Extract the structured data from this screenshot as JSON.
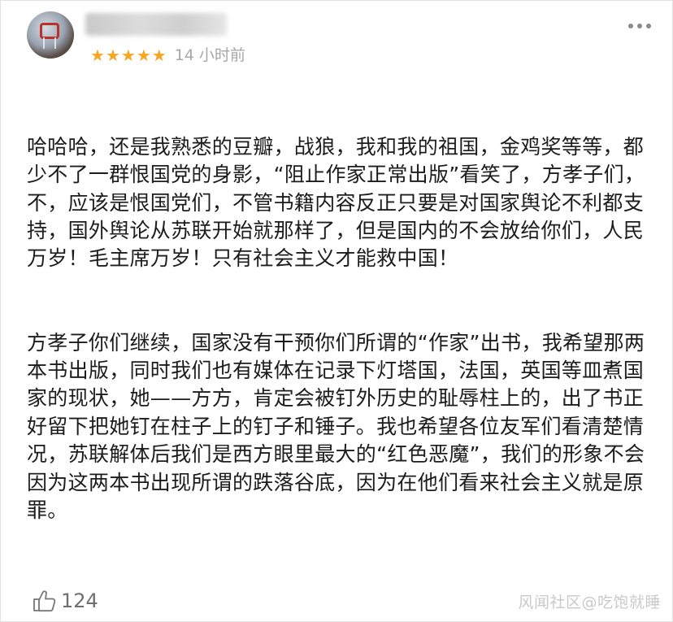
{
  "review": {
    "rating_stars": 5,
    "time": "14 小时前",
    "paragraphs": [
      "哈哈哈，还是我熟悉的豆瓣，战狼，我和我的祖国，金鸡奖等等，都少不了一群恨国党的身影，“阻止作家正常出版”看笑了，方孝子们，不，应该是恨国党们，不管书籍内容反正只要是对国家舆论不利都支持，国外舆论从苏联开始就那样了，但是国内的不会放给你们，人民万岁！毛主席万岁！只有社会主义才能救中国！",
      "方孝子你们继续，国家没有干预你们所谓的“作家”出书，我希望那两本书出版，同时我们也有媒体在记录下灯塔国，法国，英国等皿煮国家的现状，她——方方，肯定会被钉外历史的耻辱柱上的，出了书正好留下把她钉在柱子上的钉子和锤子。我也希望各位友军们看清楚情况，苏联解体后我们是西方眼里最大的“红色恶魔”，我们的形象不会因为这两本书出现所谓的跌落谷底，因为在他们看来社会主义就是原罪。"
    ],
    "like_count": "124"
  },
  "icons": {
    "more": "more-dots-icon",
    "like": "thumbs-up-icon",
    "star": "star-icon"
  },
  "colors": {
    "star": "#f5a623",
    "meta_text": "#a7a7a7",
    "body_text": "#1c1c1c"
  },
  "watermark": "风闻社区@吃饱就睡"
}
